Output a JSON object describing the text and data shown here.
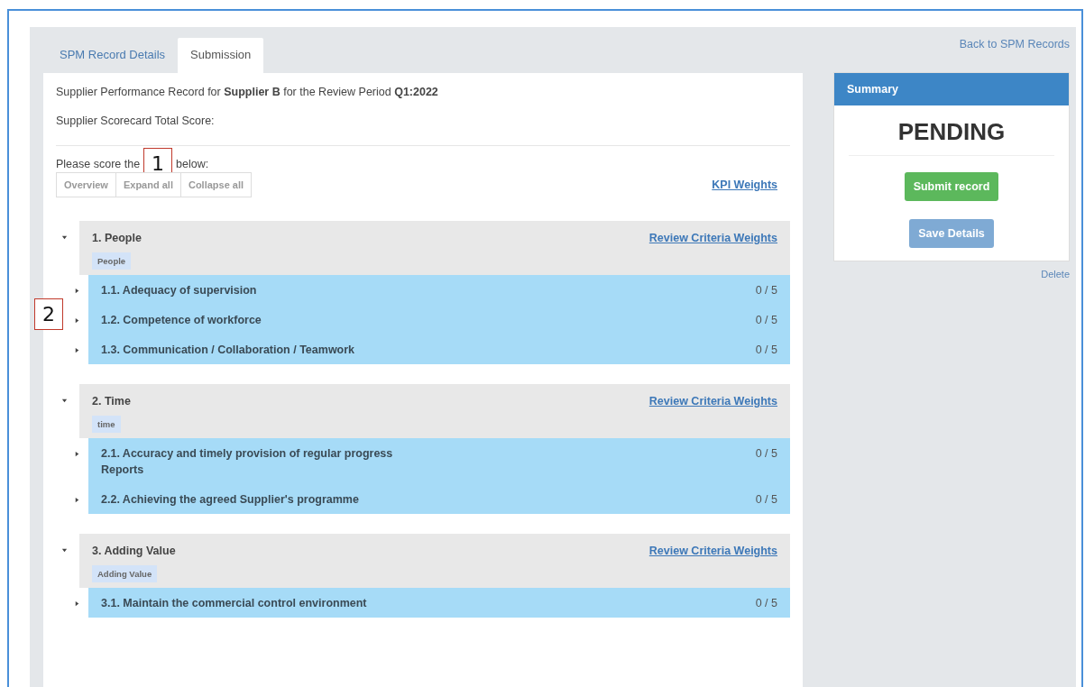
{
  "tabs": [
    {
      "label": "SPM Record Details",
      "selected": false
    },
    {
      "label": "Submission",
      "selected": true
    }
  ],
  "back_link": "Back to SPM Records",
  "record_line": "Supplier Performance Record for **Supplier B** for the Review Period **Q1:2022**",
  "total_score_label": "Supplier Scorecard Total Score:",
  "instruction_before": "Please score the",
  "instruction_after": "below:",
  "callouts": [
    {
      "label": "1"
    },
    {
      "label": "2"
    }
  ],
  "view_buttons": [
    "Overview",
    "Expand all",
    "Collapse all"
  ],
  "kpi_weights_link": "KPI Weights",
  "groups": [
    {
      "title": "1. People",
      "tag": "People",
      "link": "Review Criteria Weights",
      "expanded": true,
      "criteria": [
        {
          "title": "1.1. Adequacy of supervision",
          "score": "0 / 5",
          "expanded": false
        },
        {
          "title": "1.2. Competence of workforce",
          "score": "0 / 5",
          "expanded": false
        },
        {
          "title": "1.3. Communication / Collaboration / Teamwork",
          "score": "0 / 5",
          "expanded": false
        }
      ]
    },
    {
      "title": "2. Time",
      "tag": "time",
      "link": "Review Criteria Weights",
      "expanded": true,
      "criteria": [
        {
          "title": "2.1. Accuracy and timely provision of regular progress Reports",
          "score": "0 / 5",
          "expanded": false
        },
        {
          "title": "2.2. Achieving the agreed Supplier's programme",
          "score": "0 / 5",
          "expanded": false
        }
      ]
    },
    {
      "title": "3. Adding Value",
      "tag": "Adding Value",
      "link": "Review Criteria Weights",
      "expanded": true,
      "criteria": [
        {
          "title": "3.1. Maintain the commercial control environment",
          "score": "0 / 5",
          "expanded": false
        }
      ]
    }
  ],
  "summary": {
    "title": "Summary",
    "status": "PENDING",
    "buttons": [
      {
        "label": "Submit record",
        "kind": "primary"
      },
      {
        "label": "Save Details",
        "kind": "secondary"
      }
    ],
    "delete_link": "Delete"
  }
}
